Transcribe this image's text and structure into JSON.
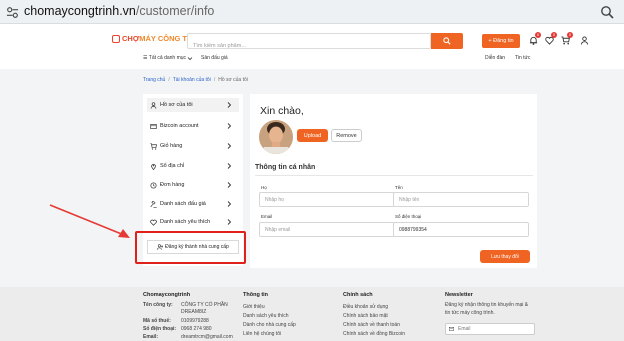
{
  "browser": {
    "host": "chomaycongtrinh.vn",
    "path": "/customer/info"
  },
  "header": {
    "logo_text_1": "CHỢ ",
    "logo_text_2": "MÁY CÔNG TRÌNH",
    "search_placeholder": "Tìm kiếm sản phẩm...",
    "register_label": "+ Đăng tin",
    "notification_count": "0",
    "wishlist_count": "0",
    "cart_count": "0"
  },
  "subnav": {
    "categories": "☰ Tất cả danh mục",
    "auction": "Sản đấu giá",
    "forum": "Diễn đàn",
    "news": "Tin tức"
  },
  "breadcrumb": {
    "home": "Trang chủ",
    "account": "Tài khoản của tôi",
    "current": "Hồ sơ của tôi"
  },
  "sidebar": {
    "items": [
      {
        "label": "Hồ sơ của tôi"
      },
      {
        "label": "Bizcoin account"
      },
      {
        "label": "Giỏ hàng"
      },
      {
        "label": "Sổ địa chỉ"
      },
      {
        "label": "Đơn hàng"
      },
      {
        "label": "Danh sách đấu giá"
      },
      {
        "label": "Danh sách yêu thích"
      }
    ],
    "register_supplier": "Đăng ký thành nhà cung cấp"
  },
  "profile": {
    "greeting": "Xin chào,",
    "upload": "Upload",
    "remove": "Remove",
    "section_title": "Thông tin cá nhân",
    "last_name_label": "Họ",
    "last_name_placeholder": "Nhập họ",
    "first_name_label": "Tên",
    "first_name_placeholder": "Nhập tên",
    "email_label": "Email",
    "email_placeholder": "Nhập email",
    "phone_label": "Số điện thoại",
    "phone_value": "0988799354",
    "save": "Lưu thay đổi"
  },
  "footer": {
    "brand": "Chomaycongtrinh",
    "company_label": "Tên công ty:",
    "company_value_1": "CÔNG TY CỔ PHẦN",
    "company_value_2": "DREAM8IZ",
    "tax_label": "Mã số thuế:",
    "tax_value": "0109979288",
    "phone_label": "Số điện thoại:",
    "phone_value": "0968 274 980",
    "email_label": "Email:",
    "email_value": "dreamtrcm@gmail.com",
    "col2_title": "Thông tin",
    "col2_items": [
      "Giới thiệu",
      "Danh sách yêu thích",
      "Dành cho nhà cung cấp",
      "Liên hệ chúng tôi"
    ],
    "col3_title": "Chính sách",
    "col3_items": [
      "Điều khoản sử dụng",
      "Chính sách bảo mật",
      "Chính sách về thanh toán",
      "Chính sách về đồng Bizcoin"
    ],
    "newsletter_title": "Newsletter",
    "newsletter_text_1": "Đăng ký nhận thông tin khuyến mại &",
    "newsletter_text_2": "tin tức máy công trình.",
    "newsletter_placeholder": "Email"
  },
  "colors": {
    "accent": "#f06423",
    "highlight_box": "#e0201a",
    "arrow": "#e53935"
  }
}
